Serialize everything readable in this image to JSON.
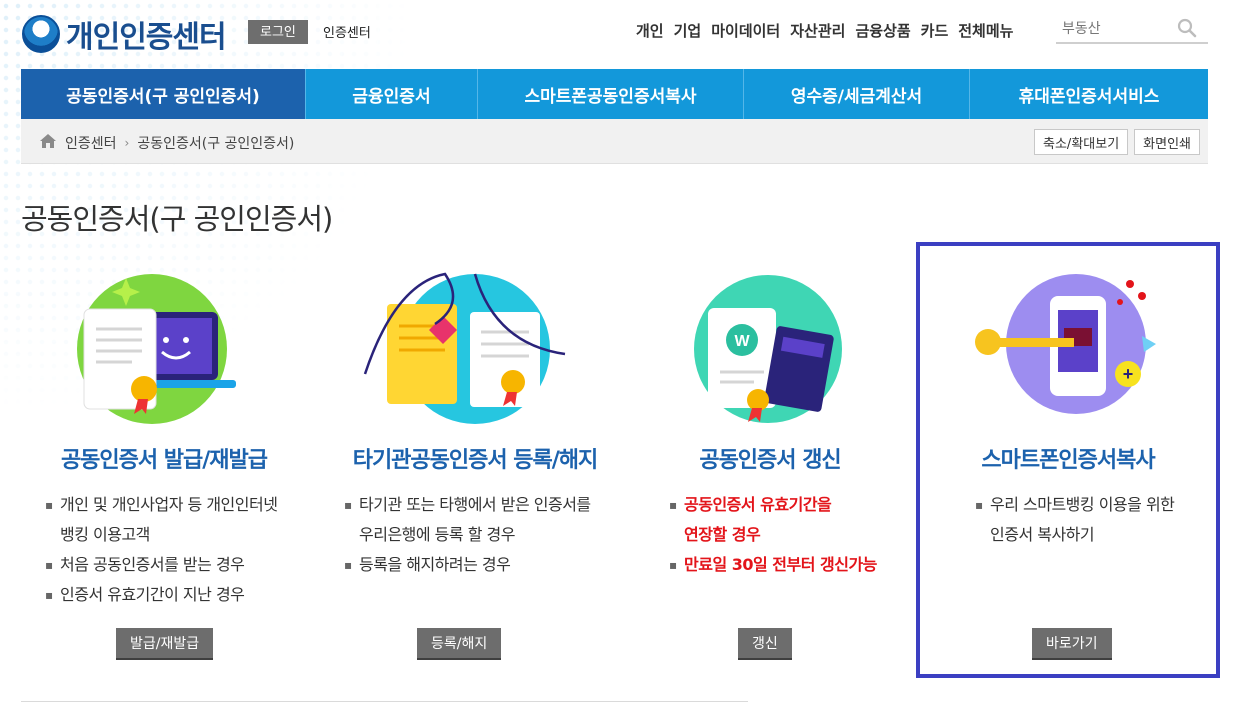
{
  "header": {
    "logo_text": "개인인증센터",
    "login_label": "로그인",
    "cert_center_link": "인증센터",
    "top_menu": [
      "개인",
      "기업",
      "마이데이터",
      "자산관리",
      "금융상품",
      "카드",
      "전체메뉴"
    ],
    "search_value": "부동산"
  },
  "nav": {
    "tabs": [
      {
        "label": "공동인증서(구 공인인증서)",
        "active": true
      },
      {
        "label": "금융인증서",
        "active": false
      },
      {
        "label": "스마트폰공동인증서복사",
        "active": false
      },
      {
        "label": "영수증/세금계산서",
        "active": false
      },
      {
        "label": "휴대폰인증서서비스",
        "active": false
      }
    ]
  },
  "breadcrumb": {
    "items": [
      "인증센터",
      "공동인증서(구 공인인증서)"
    ],
    "zoom_label": "축소/확대보기",
    "print_label": "화면인쇄"
  },
  "page_title": "공동인증서(구 공인인증서)",
  "cards": [
    {
      "title": "공동인증서 발급/재발급",
      "lines": [
        "개인 및 개인사업자 등 개인인터넷",
        "뱅킹 이용고객",
        "처음 공동인증서를 받는 경우",
        "인증서 유효기간이 지난 경우"
      ],
      "button": "발급/재발급"
    },
    {
      "title": "타기관공동인증서 등록/해지",
      "lines": [
        "타기관 또는 타행에서 받은 인증서를",
        "우리은행에 등록 할 경우",
        "등록을 해지하려는 경우"
      ],
      "button": "등록/해지"
    },
    {
      "title": "공동인증서 갱신",
      "lines": [
        "공동인증서 유효기간을",
        "연장할 경우",
        "만료일 30일 전부터 갱신가능"
      ],
      "button": "갱신"
    },
    {
      "title": "스마트폰인증서복사",
      "lines": [
        "우리 스마트뱅킹 이용을 위한",
        "인증서 복사하기"
      ],
      "button": "바로가기"
    }
  ],
  "colors": {
    "nav_bg": "#1398da",
    "nav_active": "#1c62ad",
    "card_title": "#1c62ad",
    "highlight_border": "#3b3fc2",
    "warning_text": "#e3141a"
  }
}
